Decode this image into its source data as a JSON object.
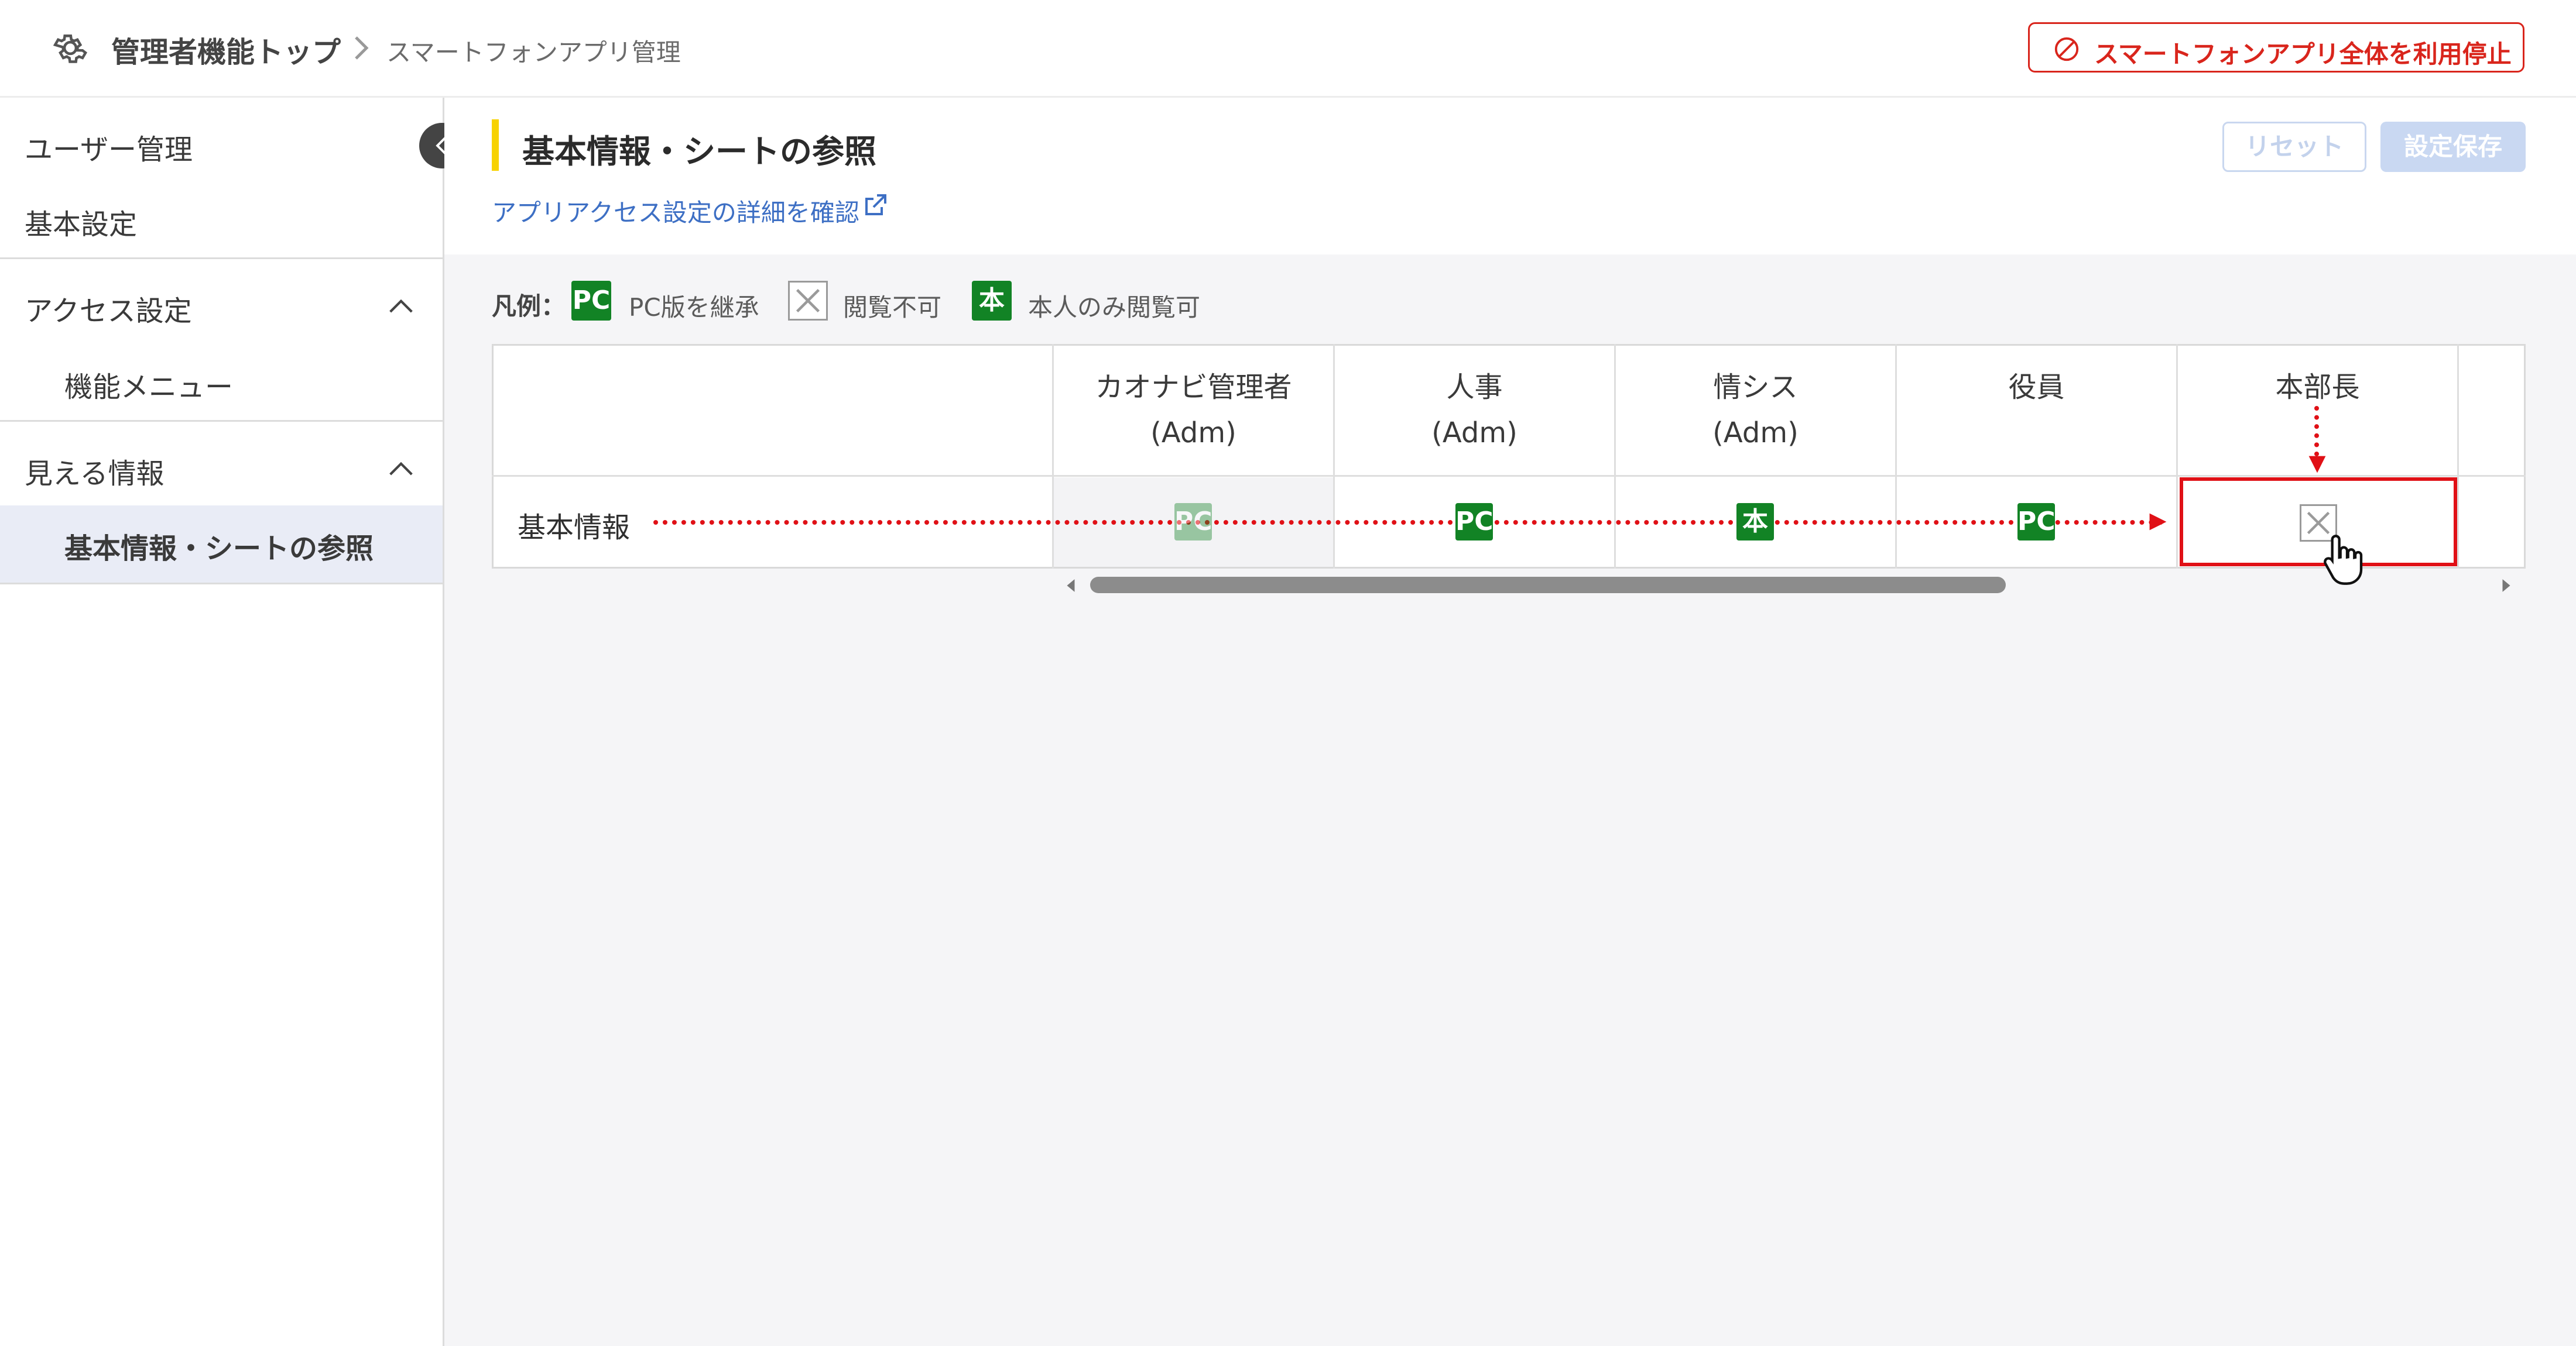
{
  "header": {
    "breadcrumb_top": "管理者機能トップ",
    "breadcrumb_current": "スマートフォンアプリ管理",
    "stop_button_label": "スマートフォンアプリ全体を利用停止",
    "icons": [
      "gear-icon",
      "chevron-right-icon",
      "prohibit-icon"
    ]
  },
  "sidebar": {
    "items": [
      {
        "label": "ユーザー管理"
      },
      {
        "label": "基本設定"
      }
    ],
    "groups": [
      {
        "label": "アクセス設定",
        "expanded": true,
        "children": [
          {
            "label": "機能メニュー"
          }
        ]
      },
      {
        "label": "見える情報",
        "expanded": true,
        "children": [
          {
            "label": "基本情報・シートの参照",
            "active": true
          }
        ]
      }
    ]
  },
  "main": {
    "title": "基本情報・シートの参照",
    "detail_link": "アプリアクセス設定の詳細を確認",
    "reset_label": "リセット",
    "save_label": "設定保存",
    "legend": {
      "label": "凡例：",
      "items": [
        {
          "badge": "PC",
          "text": "PC版を継承"
        },
        {
          "badge": "",
          "text": "閲覧不可"
        },
        {
          "badge": "本",
          "text": "本人のみ閲覧可"
        }
      ]
    },
    "table": {
      "columns": [
        {
          "name": "カオナビ管理者",
          "sub": "(Adm)"
        },
        {
          "name": "人事",
          "sub": "(Adm)"
        },
        {
          "name": "情シス",
          "sub": "(Adm)"
        },
        {
          "name": "役員",
          "sub": ""
        },
        {
          "name": "本部長",
          "sub": ""
        }
      ],
      "rows": [
        {
          "label": "基本情報",
          "cells": [
            "PC",
            "PC",
            "本",
            "PC",
            "X"
          ]
        }
      ]
    }
  },
  "colors": {
    "accent_red": "#d9251c",
    "badge_green": "#128325",
    "title_bar_yellow": "#f7d200",
    "link_blue": "#3d6fc4",
    "active_bg": "#e9ecf6"
  }
}
